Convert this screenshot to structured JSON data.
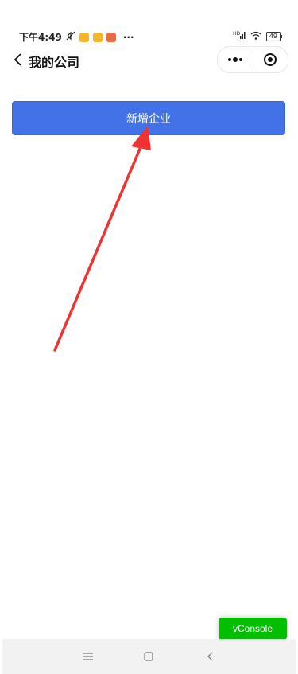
{
  "status_bar": {
    "time": "下午4:49",
    "more": "···",
    "battery": "49",
    "signal_label": "HD"
  },
  "nav": {
    "title": "我的公司"
  },
  "main": {
    "add_company_label": "新增企业"
  },
  "vconsole": {
    "label": "vConsole"
  },
  "colors": {
    "primary_button": "#4372e8",
    "vconsole": "#04be02",
    "annotation_arrow": "#f03232"
  }
}
